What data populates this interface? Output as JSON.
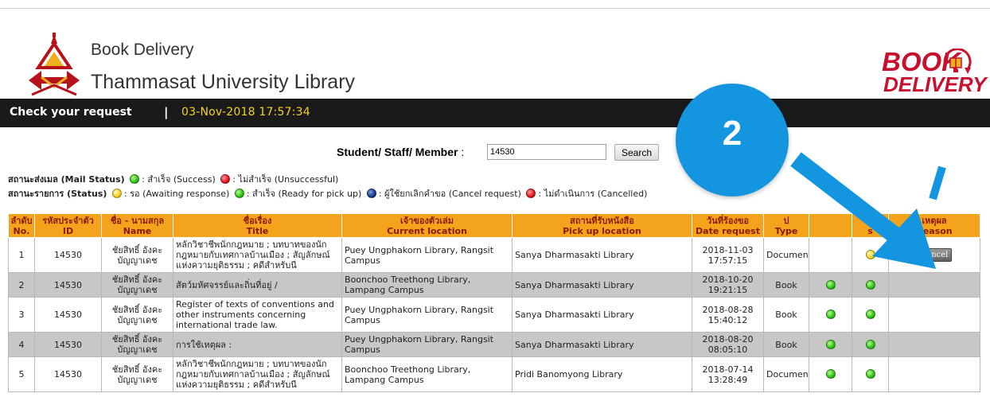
{
  "header": {
    "line1": "Book Delivery",
    "line2": "Thammasat University Library",
    "logo_word1": "BOOK",
    "logo_word2": "DELIVERY",
    "brand_color": "#c8102e"
  },
  "status_bar": {
    "label": "Check your request",
    "separator": "|",
    "datetime": "03-Nov-2018 17:57:34"
  },
  "search": {
    "label": "Student/ Staff/ Member",
    "label_suffix": " :",
    "value": "14530",
    "button": "Search"
  },
  "legend": {
    "mail_label": "สถานะส่งเมล (Mail Status)",
    "mail_success": ": สำเร็จ (Success)",
    "mail_fail": ": ไม่สำเร็จ (Unsuccessful)",
    "status_label": "สถานะรายการ (Status)",
    "status_wait": ": รอ (Awaiting response)",
    "status_ready": ": สำเร็จ (Ready for pick up)",
    "status_cancel_req": ": ผู้ใช้ยกเลิกคำขอ (Cancel request)",
    "status_cancelled": ": ไม่ดำเนินการ (Cancelled)"
  },
  "table": {
    "headers": [
      {
        "th": "ลำดับ",
        "en": "No."
      },
      {
        "th": "รหัสประจำตัว",
        "en": "ID"
      },
      {
        "th": "ชื่อ - นามสกุล",
        "en": "Name"
      },
      {
        "th": "ชื่อเรื่อง",
        "en": "Title"
      },
      {
        "th": "เจ้าของตัวเล่ม",
        "en": "Current location"
      },
      {
        "th": "สถานที่รับหนังสือ",
        "en": "Pick up location"
      },
      {
        "th": "วันที่ร้องขอ",
        "en": "Date request"
      },
      {
        "th": "ป",
        "en": "Type"
      },
      {
        "th": "",
        "en": ""
      },
      {
        "th": "ะ",
        "en": "s"
      },
      {
        "th": "เหตุผล",
        "en": "Reason"
      }
    ],
    "rows": [
      {
        "no": "1",
        "id": "14530",
        "name": "ชัยสิทธิ์ อังคะบัญญาเดช",
        "title": "หลักวิชาชีพนักกฎหมาย ; บทบาทของนักกฎหมายกับเทศกาลบ้านเมือง ; สัญลักษณ์แห่งความยุติธรรม ; คดีสำหรับนี",
        "current": "Puey Ungphakorn Library, Rangsit Campus",
        "pickup": "Sanya Dharmasakti Library",
        "date": "2018-11-03",
        "time": "17:57:15",
        "type": "Documen",
        "mail": "",
        "status": "yellow",
        "reason": "Cancel"
      },
      {
        "no": "2",
        "id": "14530",
        "name": "ชัยสิทธิ์ อังคะบัญญาเดช",
        "title": "สัตว์มหัศจรรย์และถิ่นที่อยู่ /",
        "current": "Boonchoo Treethong Library, Lampang Campus",
        "pickup": "Sanya Dharmasakti Library",
        "date": "2018-10-20",
        "time": "19:21:15",
        "type": "Book",
        "mail": "green",
        "status": "green",
        "reason": ""
      },
      {
        "no": "3",
        "id": "14530",
        "name": "ชัยสิทธิ์ อังคะบัญญาเดช",
        "title": "Register of texts of conventions and other instruments concerning international trade law.",
        "current": "Puey Ungphakorn Library, Rangsit Campus",
        "pickup": "Sanya Dharmasakti Library",
        "date": "2018-08-28",
        "time": "15:40:12",
        "type": "Book",
        "mail": "green",
        "status": "green",
        "reason": ""
      },
      {
        "no": "4",
        "id": "14530",
        "name": "ชัยสิทธิ์ อังคะบัญญาเดช",
        "title": "การใช้เหตุผล :",
        "current": "Puey Ungphakorn Library, Rangsit Campus",
        "pickup": "Sanya Dharmasakti Library",
        "date": "2018-08-20",
        "time": "08:05:10",
        "type": "Book",
        "mail": "green",
        "status": "green",
        "reason": ""
      },
      {
        "no": "5",
        "id": "14530",
        "name": "ชัยสิทธิ์ อังคะบัญญาเดช",
        "title": "หลักวิชาชีพนักกฎหมาย ; บทบาทของนักกฎหมายกับเทศกาลบ้านเมือง ; สัญลักษณ์แห่งความยุติธรรม ; คดีสำหรับนี",
        "current": "Boonchoo Treethong Library, Lampang Campus",
        "pickup": "Pridi Banomyong Library",
        "date": "2018-07-14",
        "time": "13:28:49",
        "type": "Document",
        "mail": "green",
        "status": "green",
        "reason": ""
      }
    ]
  },
  "overlay": {
    "number": "2",
    "color": "#1495e0"
  }
}
